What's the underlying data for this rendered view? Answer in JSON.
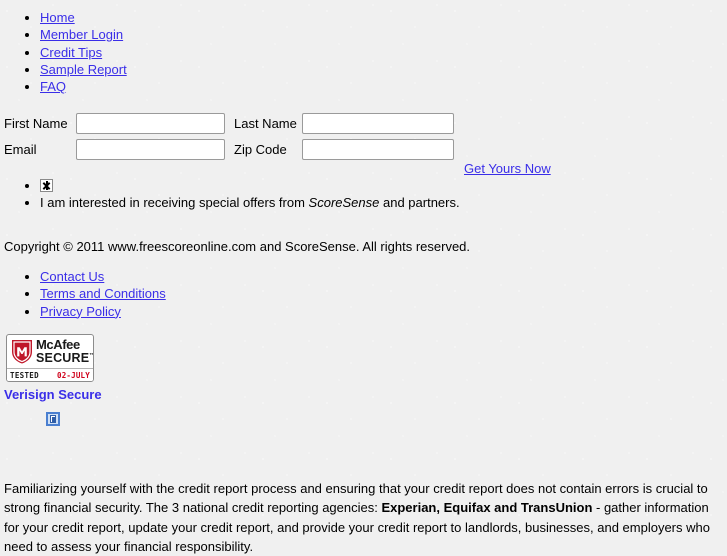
{
  "page": {
    "background_color": "#f0f0f0",
    "link_color": "#3a2ee8",
    "text_color": "#000000"
  },
  "top_nav": {
    "items": [
      {
        "label": "Home"
      },
      {
        "label": "Member Login"
      },
      {
        "label": "Credit Tips"
      },
      {
        "label": "Sample Report"
      },
      {
        "label": "FAQ"
      }
    ]
  },
  "form": {
    "fields": {
      "first_name": {
        "label": "First Name",
        "value": "",
        "placeholder": ""
      },
      "last_name": {
        "label": "Last Name",
        "value": "",
        "placeholder": ""
      },
      "email": {
        "label": "Email",
        "value": "",
        "placeholder": ""
      },
      "zip_code": {
        "label": "Zip Code",
        "value": "",
        "placeholder": ""
      }
    },
    "submit_link": "Get Yours Now"
  },
  "offers": {
    "checkbox_icon": "broken-image-icon",
    "text_before_brand": "I am interested in receiving special offers from ",
    "brand": "ScoreSense",
    "text_after_brand": " and partners."
  },
  "copyright": "Copyright © 2011 www.freescoreonline.com and ScoreSense. All rights reserved.",
  "footer_links": {
    "items": [
      {
        "label": "Contact Us"
      },
      {
        "label": "Terms and Conditions"
      },
      {
        "label": "Privacy Policy"
      }
    ]
  },
  "trust_badges": {
    "mcafee": {
      "brand_line_1": "McAfee",
      "brand_line_2": "SECURE",
      "trademark": "™",
      "tested_label": "TESTED",
      "tested_date": "02-JULY",
      "shield_color": "#c0172a",
      "date_color": "#d0021b"
    },
    "verisign": {
      "label": "Verisign Secure",
      "image_icon": "broken-image-icon"
    }
  },
  "bottom_paragraph": {
    "part_1": "Familiarizing yourself with the credit report process and ensuring that your credit report does not contain errors is crucial to strong financial security. The 3 national credit reporting agencies: ",
    "bureaus": "Experian, Equifax and TransUnion",
    "part_2": " - gather information for your credit report, update your credit report, and provide your credit report to landlords, businesses, and employers who need to assess your financial responsibility."
  }
}
